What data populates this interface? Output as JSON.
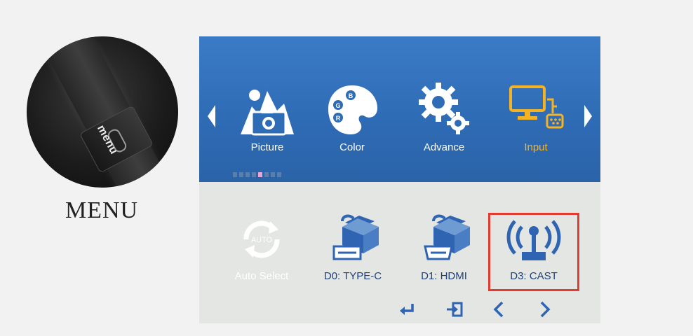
{
  "photo": {
    "button_text": "menu",
    "caption": "MENU"
  },
  "osd": {
    "categories": [
      {
        "label": "Picture",
        "icon": "picture-icon",
        "selected": false
      },
      {
        "label": "Color",
        "icon": "palette-icon",
        "selected": false
      },
      {
        "label": "Advance",
        "icon": "gears-icon",
        "selected": false
      },
      {
        "label": "Input",
        "icon": "monitor-input-icon",
        "selected": true
      }
    ],
    "page_dots": 8,
    "active_dot_index": 4,
    "sources": [
      {
        "label": "Auto Select",
        "icon": "auto-select-icon",
        "enabled": false,
        "icon_text": "AUTO"
      },
      {
        "label": "D0: TYPE-C",
        "icon": "usb-cable-icon",
        "enabled": true
      },
      {
        "label": "D1: HDMI",
        "icon": "hdmi-cable-icon",
        "enabled": true
      },
      {
        "label": "D3: CAST",
        "icon": "cast-antenna-icon",
        "enabled": true,
        "highlighted": true
      }
    ],
    "nav_buttons": [
      "enter-icon",
      "exit-icon",
      "left-icon",
      "right-icon"
    ],
    "colors": {
      "top_bg": "#2f6cb6",
      "bottom_bg": "#e4e6e3",
      "selected_label": "#f5b324",
      "icon_blue": "#2f64b3",
      "highlight_border": "#e23b32"
    }
  }
}
